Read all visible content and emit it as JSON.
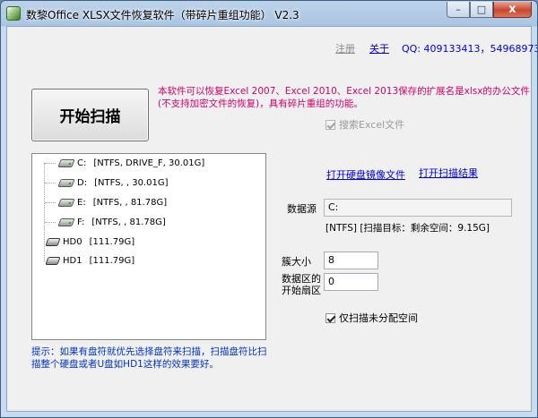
{
  "window": {
    "title": "数黎Office XLSX文件恢复软件（带碎片重组功能） V2.3",
    "minimize_glyph": "–",
    "maximize_glyph": "□",
    "close_glyph": "x"
  },
  "top_links": {
    "register": "注册",
    "about": "关于",
    "qq": "QQ: 409133413，54968973"
  },
  "start_button": "开始扫描",
  "description": "本软件可以恢复Excel 2007、Excel 2010、Excel 2013保存的扩展名是xlsx的办公文件(不支持加密文件的恢复)，具有碎片重组的功能。",
  "search_excel": {
    "label": "搜索Excel文件",
    "checked": true,
    "disabled": true
  },
  "drives": [
    {
      "name": "C:",
      "info": "[NTFS, DRIVE_F, 30.01G]",
      "type": "partition"
    },
    {
      "name": "D:",
      "info": "[NTFS, , 30.01G]",
      "type": "partition"
    },
    {
      "name": "E:",
      "info": "[NTFS, , 81.78G]",
      "type": "partition"
    },
    {
      "name": "F:",
      "info": "[NTFS, , 81.78G]",
      "type": "partition"
    },
    {
      "name": "HD0",
      "info": "[111.79G]",
      "type": "disk"
    },
    {
      "name": "HD1",
      "info": "[111.79G]",
      "type": "disk"
    }
  ],
  "links": {
    "open_image": "打开硬盘镜像文件",
    "open_results": "打开扫描结果"
  },
  "source": {
    "label": "数据源",
    "value": "C:",
    "status": "[NTFS]  [扫描目标：剩余空间：9.15G]"
  },
  "cluster": {
    "label": "簇大小",
    "value": "8"
  },
  "start_sector": {
    "label_line1": "数据区的",
    "label_line2": "开始扇区",
    "value": "0"
  },
  "unallocated": {
    "label": "仅扫描未分配空间",
    "checked": true
  },
  "tip": "提示：如果有盘符就优先选择盘符来扫描，扫描盘符比扫描整个硬盘或者U盘如HD1这样的效果要好。"
}
